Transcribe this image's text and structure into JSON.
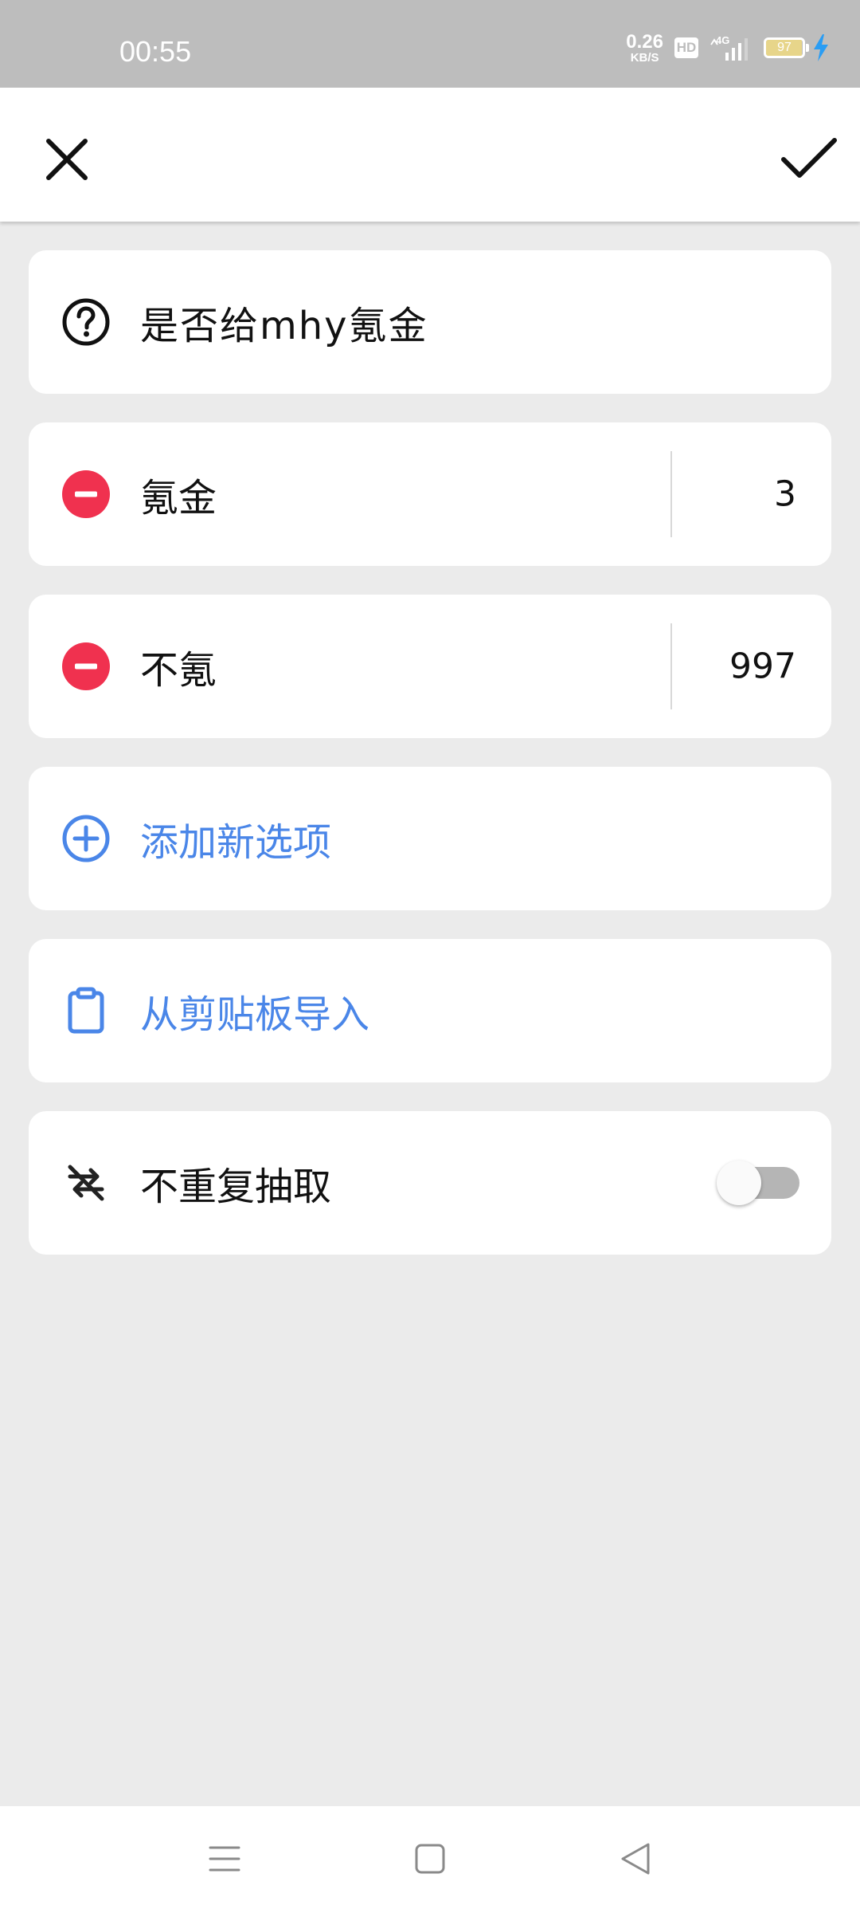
{
  "status_bar": {
    "time": "00:55",
    "net_speed_value": "0.26",
    "net_speed_unit": "KB/S",
    "hd": "HD",
    "network": "4G",
    "battery_level": "97",
    "charging": true
  },
  "toolbar": {
    "close_icon": "close-icon",
    "confirm_icon": "check-icon"
  },
  "question": {
    "icon": "question-circle-icon",
    "text": "是否给mhy氪金"
  },
  "options": [
    {
      "label": "氪金",
      "weight": "3"
    },
    {
      "label": "不氪",
      "weight": "997"
    }
  ],
  "add_option": {
    "icon": "plus-circle-icon",
    "label": "添加新选项"
  },
  "import": {
    "icon": "clipboard-icon",
    "label": "从剪贴板导入"
  },
  "no_repeat": {
    "icon": "repeat-off-icon",
    "label": "不重复抽取",
    "enabled": false
  },
  "colors": {
    "accent_blue": "#4a86e8",
    "remove_red": "#f0314f",
    "background": "#ebebeb"
  },
  "nav": {
    "menu_icon": "menu-icon",
    "home_icon": "home-square-icon",
    "back_icon": "back-triangle-icon"
  }
}
